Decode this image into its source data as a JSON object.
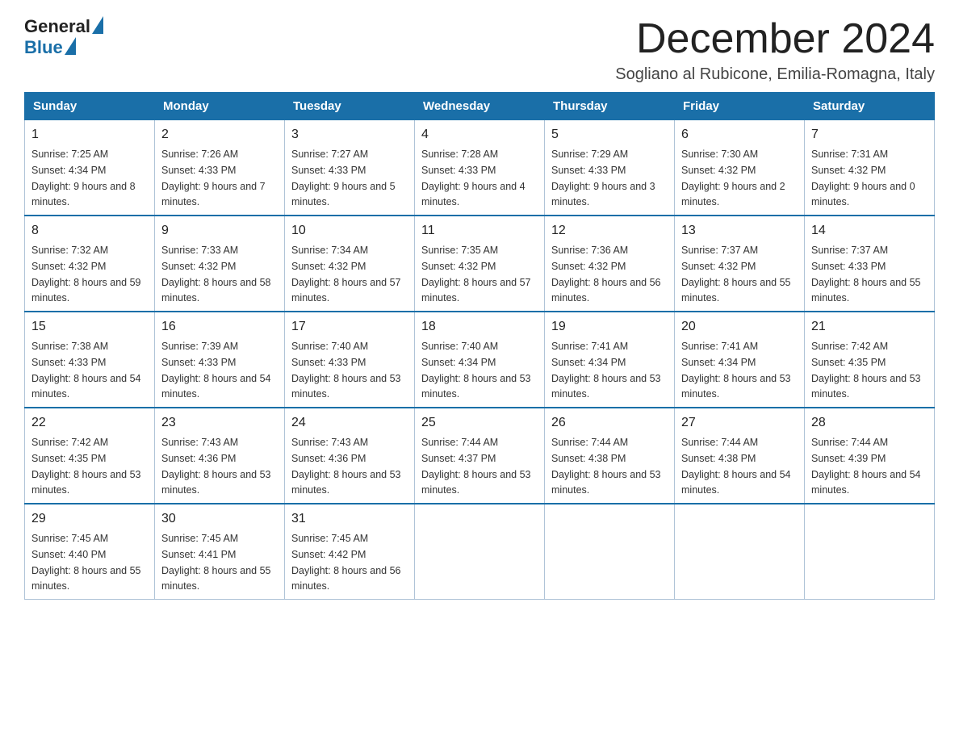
{
  "header": {
    "logo_line1": "General",
    "logo_line2": "Blue",
    "month_title": "December 2024",
    "location": "Sogliano al Rubicone, Emilia-Romagna, Italy"
  },
  "weekdays": [
    "Sunday",
    "Monday",
    "Tuesday",
    "Wednesday",
    "Thursday",
    "Friday",
    "Saturday"
  ],
  "weeks": [
    [
      {
        "day": 1,
        "sunrise": "7:25 AM",
        "sunset": "4:34 PM",
        "daylight": "9 hours and 8 minutes."
      },
      {
        "day": 2,
        "sunrise": "7:26 AM",
        "sunset": "4:33 PM",
        "daylight": "9 hours and 7 minutes."
      },
      {
        "day": 3,
        "sunrise": "7:27 AM",
        "sunset": "4:33 PM",
        "daylight": "9 hours and 5 minutes."
      },
      {
        "day": 4,
        "sunrise": "7:28 AM",
        "sunset": "4:33 PM",
        "daylight": "9 hours and 4 minutes."
      },
      {
        "day": 5,
        "sunrise": "7:29 AM",
        "sunset": "4:33 PM",
        "daylight": "9 hours and 3 minutes."
      },
      {
        "day": 6,
        "sunrise": "7:30 AM",
        "sunset": "4:32 PM",
        "daylight": "9 hours and 2 minutes."
      },
      {
        "day": 7,
        "sunrise": "7:31 AM",
        "sunset": "4:32 PM",
        "daylight": "9 hours and 0 minutes."
      }
    ],
    [
      {
        "day": 8,
        "sunrise": "7:32 AM",
        "sunset": "4:32 PM",
        "daylight": "8 hours and 59 minutes."
      },
      {
        "day": 9,
        "sunrise": "7:33 AM",
        "sunset": "4:32 PM",
        "daylight": "8 hours and 58 minutes."
      },
      {
        "day": 10,
        "sunrise": "7:34 AM",
        "sunset": "4:32 PM",
        "daylight": "8 hours and 57 minutes."
      },
      {
        "day": 11,
        "sunrise": "7:35 AM",
        "sunset": "4:32 PM",
        "daylight": "8 hours and 57 minutes."
      },
      {
        "day": 12,
        "sunrise": "7:36 AM",
        "sunset": "4:32 PM",
        "daylight": "8 hours and 56 minutes."
      },
      {
        "day": 13,
        "sunrise": "7:37 AM",
        "sunset": "4:32 PM",
        "daylight": "8 hours and 55 minutes."
      },
      {
        "day": 14,
        "sunrise": "7:37 AM",
        "sunset": "4:33 PM",
        "daylight": "8 hours and 55 minutes."
      }
    ],
    [
      {
        "day": 15,
        "sunrise": "7:38 AM",
        "sunset": "4:33 PM",
        "daylight": "8 hours and 54 minutes."
      },
      {
        "day": 16,
        "sunrise": "7:39 AM",
        "sunset": "4:33 PM",
        "daylight": "8 hours and 54 minutes."
      },
      {
        "day": 17,
        "sunrise": "7:40 AM",
        "sunset": "4:33 PM",
        "daylight": "8 hours and 53 minutes."
      },
      {
        "day": 18,
        "sunrise": "7:40 AM",
        "sunset": "4:34 PM",
        "daylight": "8 hours and 53 minutes."
      },
      {
        "day": 19,
        "sunrise": "7:41 AM",
        "sunset": "4:34 PM",
        "daylight": "8 hours and 53 minutes."
      },
      {
        "day": 20,
        "sunrise": "7:41 AM",
        "sunset": "4:34 PM",
        "daylight": "8 hours and 53 minutes."
      },
      {
        "day": 21,
        "sunrise": "7:42 AM",
        "sunset": "4:35 PM",
        "daylight": "8 hours and 53 minutes."
      }
    ],
    [
      {
        "day": 22,
        "sunrise": "7:42 AM",
        "sunset": "4:35 PM",
        "daylight": "8 hours and 53 minutes."
      },
      {
        "day": 23,
        "sunrise": "7:43 AM",
        "sunset": "4:36 PM",
        "daylight": "8 hours and 53 minutes."
      },
      {
        "day": 24,
        "sunrise": "7:43 AM",
        "sunset": "4:36 PM",
        "daylight": "8 hours and 53 minutes."
      },
      {
        "day": 25,
        "sunrise": "7:44 AM",
        "sunset": "4:37 PM",
        "daylight": "8 hours and 53 minutes."
      },
      {
        "day": 26,
        "sunrise": "7:44 AM",
        "sunset": "4:38 PM",
        "daylight": "8 hours and 53 minutes."
      },
      {
        "day": 27,
        "sunrise": "7:44 AM",
        "sunset": "4:38 PM",
        "daylight": "8 hours and 54 minutes."
      },
      {
        "day": 28,
        "sunrise": "7:44 AM",
        "sunset": "4:39 PM",
        "daylight": "8 hours and 54 minutes."
      }
    ],
    [
      {
        "day": 29,
        "sunrise": "7:45 AM",
        "sunset": "4:40 PM",
        "daylight": "8 hours and 55 minutes."
      },
      {
        "day": 30,
        "sunrise": "7:45 AM",
        "sunset": "4:41 PM",
        "daylight": "8 hours and 55 minutes."
      },
      {
        "day": 31,
        "sunrise": "7:45 AM",
        "sunset": "4:42 PM",
        "daylight": "8 hours and 56 minutes."
      },
      null,
      null,
      null,
      null
    ]
  ]
}
